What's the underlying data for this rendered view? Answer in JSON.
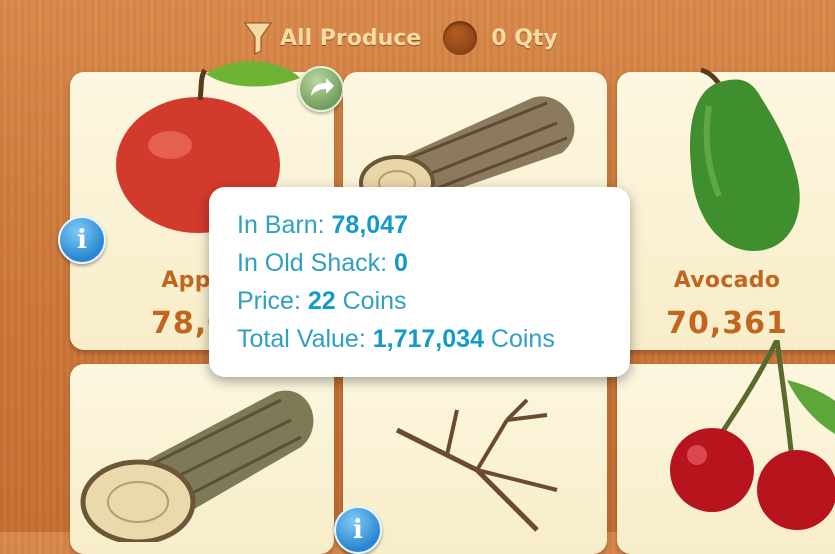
{
  "filter": {
    "label": "All Produce",
    "icon": "funnel-icon"
  },
  "quantity": {
    "label": "0 Qty",
    "icon": "qty-circle-icon"
  },
  "items": [
    {
      "name": "Appl",
      "count": "78,0",
      "icon": "apple-icon"
    },
    {
      "name": "",
      "count": "",
      "icon": "log-icon"
    },
    {
      "name": "Avocado",
      "count": "70,361",
      "icon": "avocado-icon"
    },
    {
      "name": "",
      "count": "",
      "icon": "log-icon"
    },
    {
      "name": "",
      "count": "",
      "icon": "branch-icon"
    },
    {
      "name": "",
      "count": "",
      "icon": "cherry-icon"
    }
  ],
  "tooltip": {
    "barn_label": "In Barn:",
    "barn_value": "78,047",
    "shack_label": "In Old Shack:",
    "shack_value": "0",
    "price_label": "Price:",
    "price_value": "22",
    "price_unit": "Coins",
    "total_label": "Total Value:",
    "total_value": "1,717,034",
    "total_unit": "Coins"
  },
  "colors": {
    "accent_text": "#c2661f",
    "tooltip_value": "#139ac8",
    "info_blue": "#2a86d1"
  }
}
